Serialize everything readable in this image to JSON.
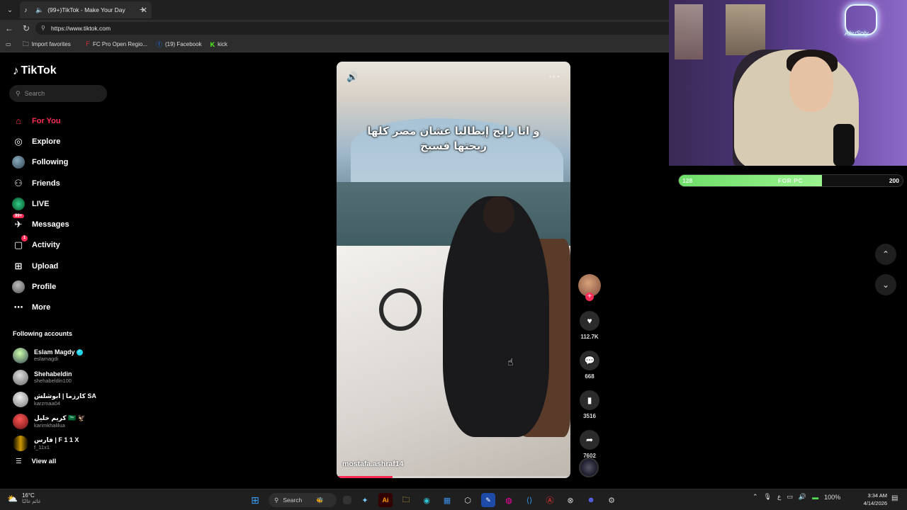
{
  "browser": {
    "tab_title": "(99+)TikTok - Make Your Day",
    "url": "https://www.tiktok.com",
    "bookmarks": [
      {
        "icon": "folder-icon",
        "label": "Import favorites"
      },
      {
        "icon": "fc-icon",
        "label": "FC Pro Open Regio..."
      },
      {
        "icon": "facebook-icon",
        "label": "(19) Facebook"
      },
      {
        "icon": "kick-icon",
        "label": "kick"
      }
    ]
  },
  "sidebar": {
    "logo": "TikTok",
    "search_placeholder": "Search",
    "nav": [
      {
        "label": "For You",
        "icon": "home-icon",
        "active": true
      },
      {
        "label": "Explore",
        "icon": "compass-icon"
      },
      {
        "label": "Following",
        "icon": "following-icon"
      },
      {
        "label": "Friends",
        "icon": "friends-icon"
      },
      {
        "label": "LIVE",
        "icon": "live-icon"
      },
      {
        "label": "Messages",
        "icon": "messages-icon",
        "badge": "99+"
      },
      {
        "label": "Activity",
        "icon": "activity-icon",
        "badge": "1"
      },
      {
        "label": "Upload",
        "icon": "upload-icon"
      },
      {
        "label": "Profile",
        "icon": "profile-avatar"
      },
      {
        "label": "More",
        "icon": "more-icon"
      }
    ],
    "following_title": "Following accounts",
    "following": [
      {
        "name": "Eslam Magdy",
        "handle": "eslamagdi",
        "verified": true
      },
      {
        "name": "Shehabeldin",
        "handle": "shehabeldin100"
      },
      {
        "name": "كارزما | ابوشلش SA",
        "handle": "karzmaa04"
      },
      {
        "name": "كريم خليل 🇸🇦 🦅",
        "handle": "karimkhalilua"
      },
      {
        "name": "فارس | F 1 1 X",
        "handle": "f_11x1"
      }
    ],
    "view_all": "View all"
  },
  "video": {
    "caption": "و انا رايح إيطاليا عشان مصر كلها ريحتها فسيخ",
    "author": "mostafa.ashraf14",
    "progress": 0.24
  },
  "actions": {
    "likes": "112.7K",
    "comments": "668",
    "saves": "3516",
    "shares": "7602"
  },
  "overlay": {
    "goal_start": "128",
    "goal_label": "FOR PC",
    "goal_end": "200",
    "goal_fraction": 0.64,
    "neon_text": "AbuSoly"
  },
  "taskbar": {
    "temp": "16°C",
    "weather_text": "غائم غالبًا",
    "search": "Search",
    "battery": "100%",
    "time": "3:34 AM",
    "date": "4/14/2026",
    "lang": "ع"
  },
  "colors": {
    "accent": "#fe2c55",
    "goal_green": "#6fde6a"
  }
}
